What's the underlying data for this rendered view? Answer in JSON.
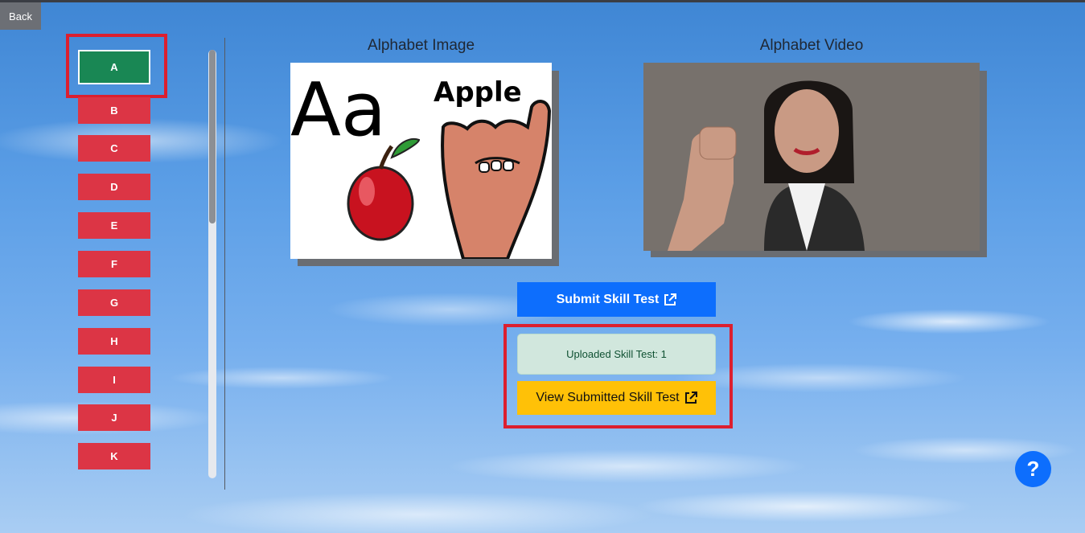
{
  "header": {
    "back_label": "Back"
  },
  "sidebar": {
    "letters": [
      "A",
      "B",
      "C",
      "D",
      "E",
      "F",
      "G",
      "H",
      "I",
      "J",
      "K"
    ],
    "selected": "A"
  },
  "main": {
    "image_heading": "Alphabet Image",
    "video_heading": "Alphabet Video",
    "image_caption_big": "Aa",
    "image_caption_word": "Apple",
    "submit_label": "Submit Skill Test",
    "uploaded_text": "Uploaded Skill Test: 1",
    "view_label": "View Submitted Skill Test",
    "help_label": "?"
  },
  "colors": {
    "selected_letter": "#198754",
    "letter": "#dc3545",
    "submit": "#0d6efd",
    "view": "#ffc107",
    "highlight": "#dc1f2f"
  }
}
